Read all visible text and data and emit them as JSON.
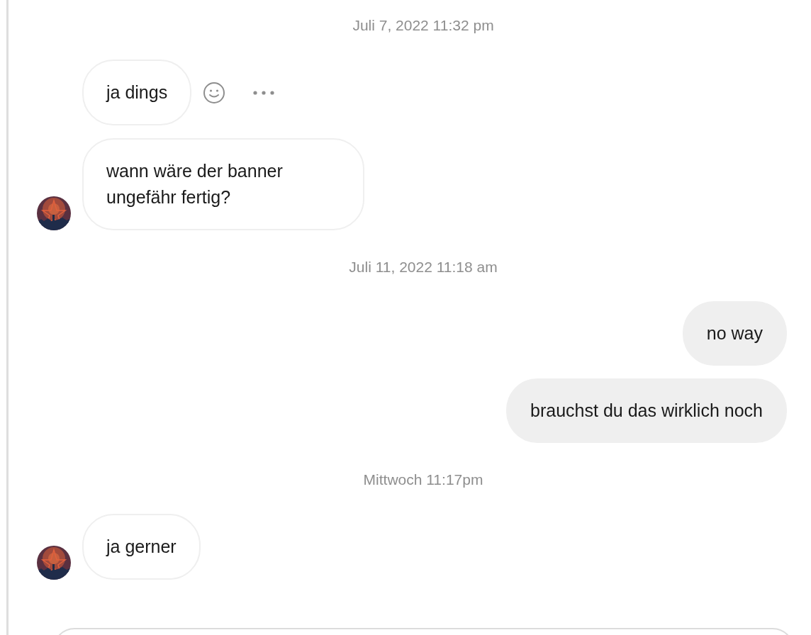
{
  "messages": [
    {
      "kind": "timestamp",
      "text": "Juli 7, 2022 11:32 pm"
    },
    {
      "kind": "incoming",
      "text": "ja dings",
      "avatar": false,
      "actions": true
    },
    {
      "kind": "incoming",
      "text": "wann wäre der banner ungefähr fertig?",
      "avatar": true,
      "actions": false
    },
    {
      "kind": "timestamp",
      "text": "Juli 11, 2022 11:18 am"
    },
    {
      "kind": "outgoing",
      "text": "no way"
    },
    {
      "kind": "outgoing",
      "text": "brauchst du das wirklich noch"
    },
    {
      "kind": "timestamp",
      "text": "Mittwoch 11:17pm"
    },
    {
      "kind": "incoming",
      "text": "ja gerner",
      "avatar": true,
      "actions": false
    }
  ]
}
